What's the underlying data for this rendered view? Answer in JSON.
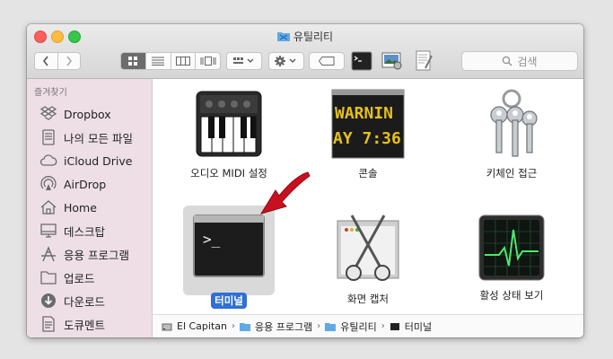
{
  "window": {
    "title": "유틸리티"
  },
  "toolbar": {
    "search_placeholder": "검색",
    "view_modes": [
      "icon",
      "list",
      "column",
      "coverflow"
    ]
  },
  "sidebar": {
    "header": "즐겨찾기",
    "items": [
      {
        "label": "Dropbox",
        "icon": "dropbox-icon"
      },
      {
        "label": "나의 모든 파일",
        "icon": "all-files-icon"
      },
      {
        "label": "iCloud Drive",
        "icon": "cloud-icon"
      },
      {
        "label": "AirDrop",
        "icon": "airdrop-icon"
      },
      {
        "label": "Home",
        "icon": "home-icon"
      },
      {
        "label": "데스크탑",
        "icon": "desktop-icon"
      },
      {
        "label": "응용 프로그램",
        "icon": "applications-icon"
      },
      {
        "label": "업로드",
        "icon": "folder-icon"
      },
      {
        "label": "다운로드",
        "icon": "download-icon"
      },
      {
        "label": "도큐멘트",
        "icon": "document-icon"
      }
    ]
  },
  "files": [
    {
      "label": "오디오 MIDI 설정",
      "icon": "midi-keyboard-icon"
    },
    {
      "label": "콘솔",
      "icon": "console-icon",
      "display": "WARNIN AY 7:36"
    },
    {
      "label": "키체인 접근",
      "icon": "keychain-icon"
    },
    {
      "label": "터미널",
      "icon": "terminal-icon",
      "display": ">_",
      "selected": true
    },
    {
      "label": "화면 캡처",
      "icon": "screenshot-icon"
    },
    {
      "label": "활성 상태 보기",
      "icon": "activity-monitor-icon"
    }
  ],
  "pathbar": [
    "El Capitan",
    "응용 프로그램",
    "유틸리티",
    "터미널"
  ],
  "colors": {
    "selection": "#2f6fd6",
    "sidebar": "#eedfe6",
    "arrow": "#d0021b"
  }
}
